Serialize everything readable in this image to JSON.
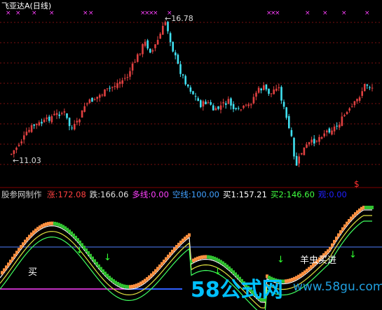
{
  "chart": {
    "title": "飞亚达A",
    "period": "(日线)",
    "price_high_label": "16.78",
    "price_low_label": "11.03",
    "signal_marker": "$"
  },
  "indicator_bar": {
    "source": "股参网制作",
    "items": [
      {
        "label": "涨:",
        "value": "172.08",
        "color": "#ff4040"
      },
      {
        "label": "跌:",
        "value": "166.06",
        "color": "#e0e0e0"
      },
      {
        "label": "多线:",
        "value": "0.00",
        "color": "#ff40ff"
      },
      {
        "label": "空线:",
        "value": "100.00",
        "color": "#40a0ff"
      },
      {
        "label": "买1:",
        "value": "157.21",
        "color": "#ffffff"
      },
      {
        "label": "买2:",
        "value": "146.60",
        "color": "#40ff40"
      },
      {
        "label": "观:",
        "value": "0.00",
        "color": "#2020ff"
      }
    ]
  },
  "annotations": {
    "buy": "买",
    "wave_buy": "羊虫买进"
  },
  "watermark": {
    "brand": "58公式网",
    "url": "www.58gu.com"
  },
  "colors": {
    "up": "#e04040",
    "down": "#40e0f0",
    "grid": "#7a1010",
    "orange": "#ff9040",
    "green": "#30c030",
    "magenta": "#ff40ff",
    "blue_line": "#3060ff"
  }
}
